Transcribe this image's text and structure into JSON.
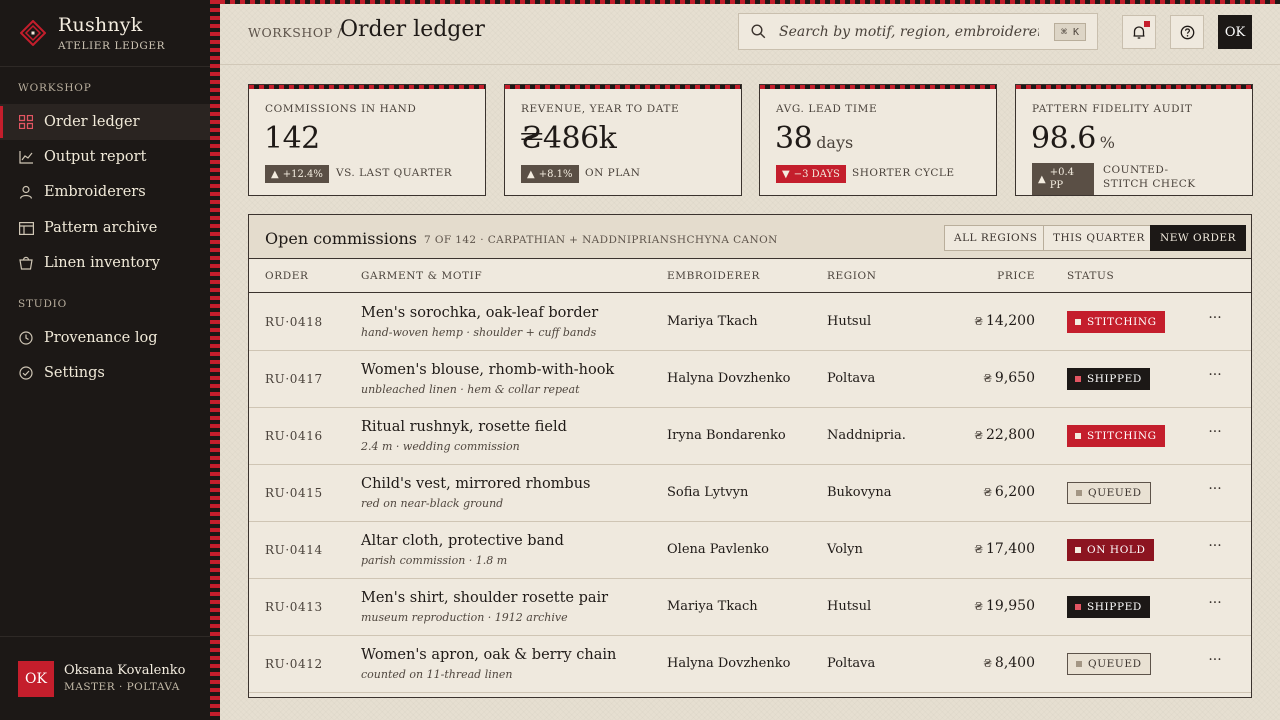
{
  "brand": {
    "name": "Rushnyk",
    "subtitle": "ATELIER LEDGER"
  },
  "sidebar": {
    "sections": [
      {
        "label": "WORKSHOP",
        "items": [
          {
            "label": "Order ledger",
            "icon": "grid-icon",
            "active": true
          },
          {
            "label": "Output report",
            "icon": "line-chart-icon"
          },
          {
            "label": "Embroiderers",
            "icon": "user-icon"
          },
          {
            "label": "Pattern archive",
            "icon": "archive-icon"
          },
          {
            "label": "Linen inventory",
            "icon": "basket-icon"
          }
        ]
      },
      {
        "label": "STUDIO",
        "items": [
          {
            "label": "Provenance log",
            "icon": "clock-icon"
          },
          {
            "label": "Settings",
            "icon": "check-circle-icon"
          }
        ]
      }
    ],
    "user": {
      "initials": "OK",
      "name": "Oksana Kovalenko",
      "role": "MASTER · POLTAVA"
    }
  },
  "topbar": {
    "breadcrumb": "WORKSHOP /",
    "title": "Order ledger",
    "search_placeholder": "Search by motif, region, embroiderer...",
    "search_shortcut": "⌘ K",
    "avatar_initials": "OK"
  },
  "kpis": [
    {
      "label": "COMMISSIONS IN HAND",
      "value": "142",
      "unit": "",
      "delta": "+12.4%",
      "direction": "up",
      "note": "VS. LAST QUARTER"
    },
    {
      "label": "REVENUE, YEAR TO DATE",
      "value": "₴486k",
      "unit": "",
      "delta": "+8.1%",
      "direction": "up",
      "note": "ON PLAN"
    },
    {
      "label": "AVG. LEAD TIME",
      "value": "38",
      "unit": "days",
      "delta": "−3 DAYS",
      "direction": "down",
      "note": "SHORTER CYCLE"
    },
    {
      "label": "PATTERN FIDELITY AUDIT",
      "value": "98.6",
      "unit": "%",
      "delta": "+0.4 PP",
      "direction": "up",
      "note": "COUNTED-STITCH CHECK"
    }
  ],
  "table": {
    "title": "Open commissions",
    "subtitle": "7 OF 142 · CARPATHIAN + NADDNIPRIANSHCHYNA CANON",
    "filters": [
      "ALL REGIONS",
      "THIS QUARTER"
    ],
    "new_label": "NEW ORDER",
    "columns": [
      "ORDER",
      "GARMENT & MOTIF",
      "EMBROIDERER",
      "REGION",
      "PRICE",
      "STATUS"
    ],
    "currency": "₴",
    "rows": [
      {
        "id": "RU·0418",
        "title": "Men's sorochka, oak-leaf border",
        "detail": "hand-woven hemp · shoulder + cuff bands",
        "embroiderer": "Mariya Tkach",
        "region": "Hutsul",
        "price": "14,200",
        "status": "STITCHING",
        "status_kind": "stitching"
      },
      {
        "id": "RU·0417",
        "title": "Women's blouse, rhomb-with-hook",
        "detail": "unbleached linen · hem & collar repeat",
        "embroiderer": "Halyna Dovzhenko",
        "region": "Poltava",
        "price": "9,650",
        "status": "SHIPPED",
        "status_kind": "shipped"
      },
      {
        "id": "RU·0416",
        "title": "Ritual rushnyk, rosette field",
        "detail": "2.4 m · wedding commission",
        "embroiderer": "Iryna Bondarenko",
        "region": "Naddnipria.",
        "price": "22,800",
        "status": "STITCHING",
        "status_kind": "stitching"
      },
      {
        "id": "RU·0415",
        "title": "Child's vest, mirrored rhombus",
        "detail": "red on near-black ground",
        "embroiderer": "Sofia Lytvyn",
        "region": "Bukovyna",
        "price": "6,200",
        "status": "QUEUED",
        "status_kind": "queued"
      },
      {
        "id": "RU·0414",
        "title": "Altar cloth, protective band",
        "detail": "parish commission · 1.8 m",
        "embroiderer": "Olena Pavlenko",
        "region": "Volyn",
        "price": "17,400",
        "status": "ON HOLD",
        "status_kind": "onhold"
      },
      {
        "id": "RU·0413",
        "title": "Men's shirt, shoulder rosette pair",
        "detail": "museum reproduction · 1912 archive",
        "embroiderer": "Mariya Tkach",
        "region": "Hutsul",
        "price": "19,950",
        "status": "SHIPPED",
        "status_kind": "shipped"
      },
      {
        "id": "RU·0412",
        "title": "Women's apron, oak & berry chain",
        "detail": "counted on 11-thread linen",
        "embroiderer": "Halyna Dovzhenko",
        "region": "Poltava",
        "price": "8,400",
        "status": "QUEUED",
        "status_kind": "queued"
      }
    ]
  },
  "colors": {
    "accent": "#c41e2c",
    "ink": "#1c1816",
    "paper": "#e6dfd1",
    "card": "#efe9de"
  }
}
